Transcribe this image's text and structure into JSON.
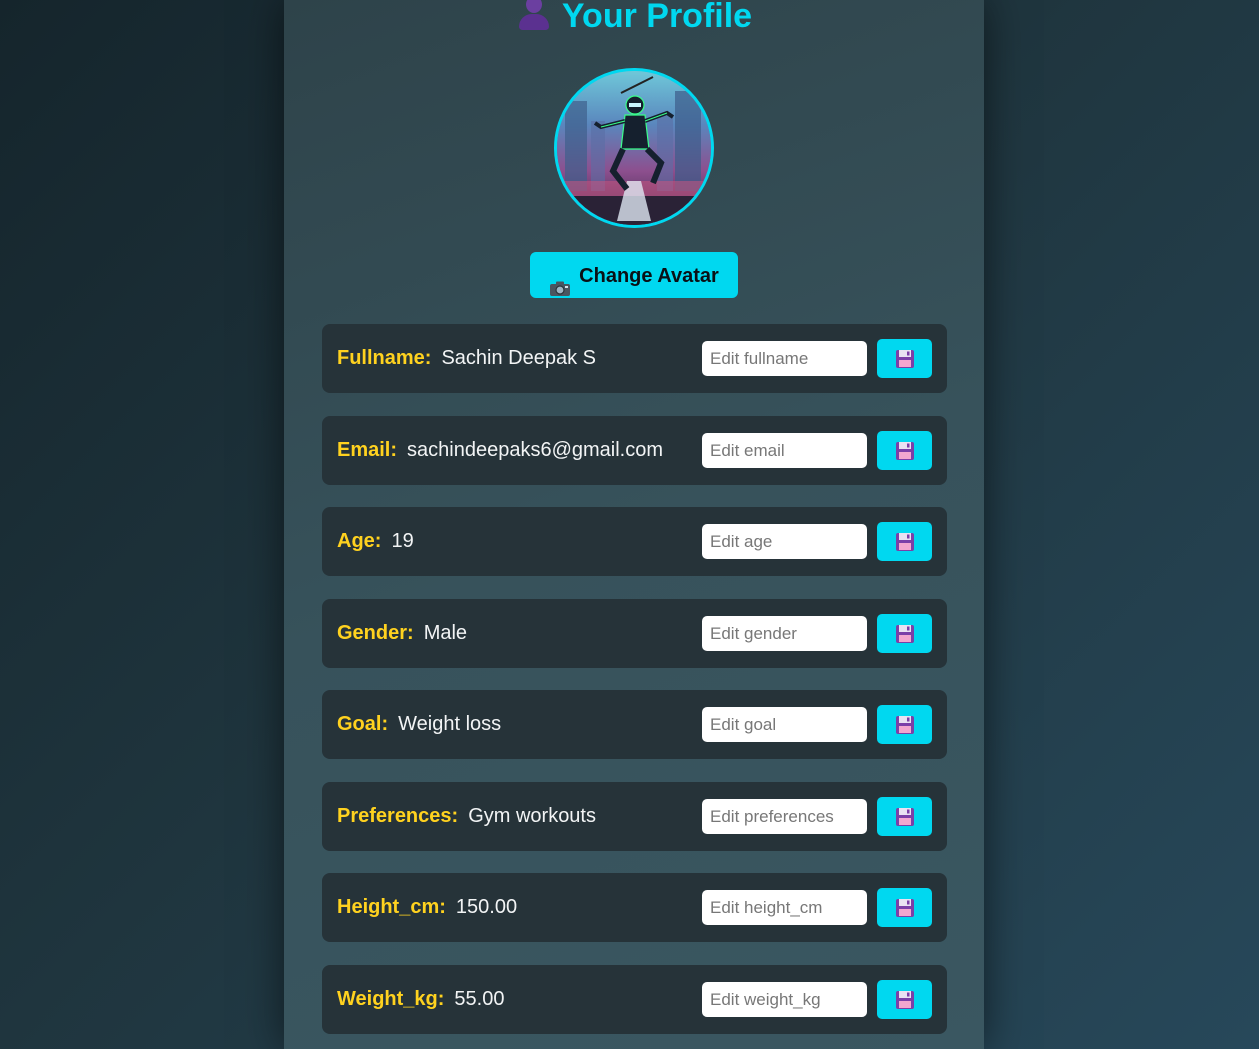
{
  "header": {
    "title": "Your Profile",
    "icon": "user-silhouette-icon"
  },
  "avatar": {
    "alt": "ninja avatar"
  },
  "change_avatar": {
    "icon": "camera-icon",
    "label": "Change Avatar"
  },
  "colors": {
    "accent": "#00d8f0",
    "label": "#ffd21f",
    "row_bg": "#263339"
  },
  "fields": [
    {
      "label": "Fullname:",
      "value": "Sachin Deepak S",
      "placeholder": "Edit fullname"
    },
    {
      "label": "Email:",
      "value": "sachindeepaks6@gmail.com",
      "placeholder": "Edit email"
    },
    {
      "label": "Age:",
      "value": "19",
      "placeholder": "Edit age"
    },
    {
      "label": "Gender:",
      "value": "Male",
      "placeholder": "Edit gender"
    },
    {
      "label": "Goal:",
      "value": "Weight loss",
      "placeholder": "Edit goal"
    },
    {
      "label": "Preferences:",
      "value": "Gym workouts",
      "placeholder": "Edit preferences"
    },
    {
      "label": "Height_cm:",
      "value": "150.00",
      "placeholder": "Edit height_cm"
    },
    {
      "label": "Weight_kg:",
      "value": "55.00",
      "placeholder": "Edit weight_kg"
    }
  ]
}
